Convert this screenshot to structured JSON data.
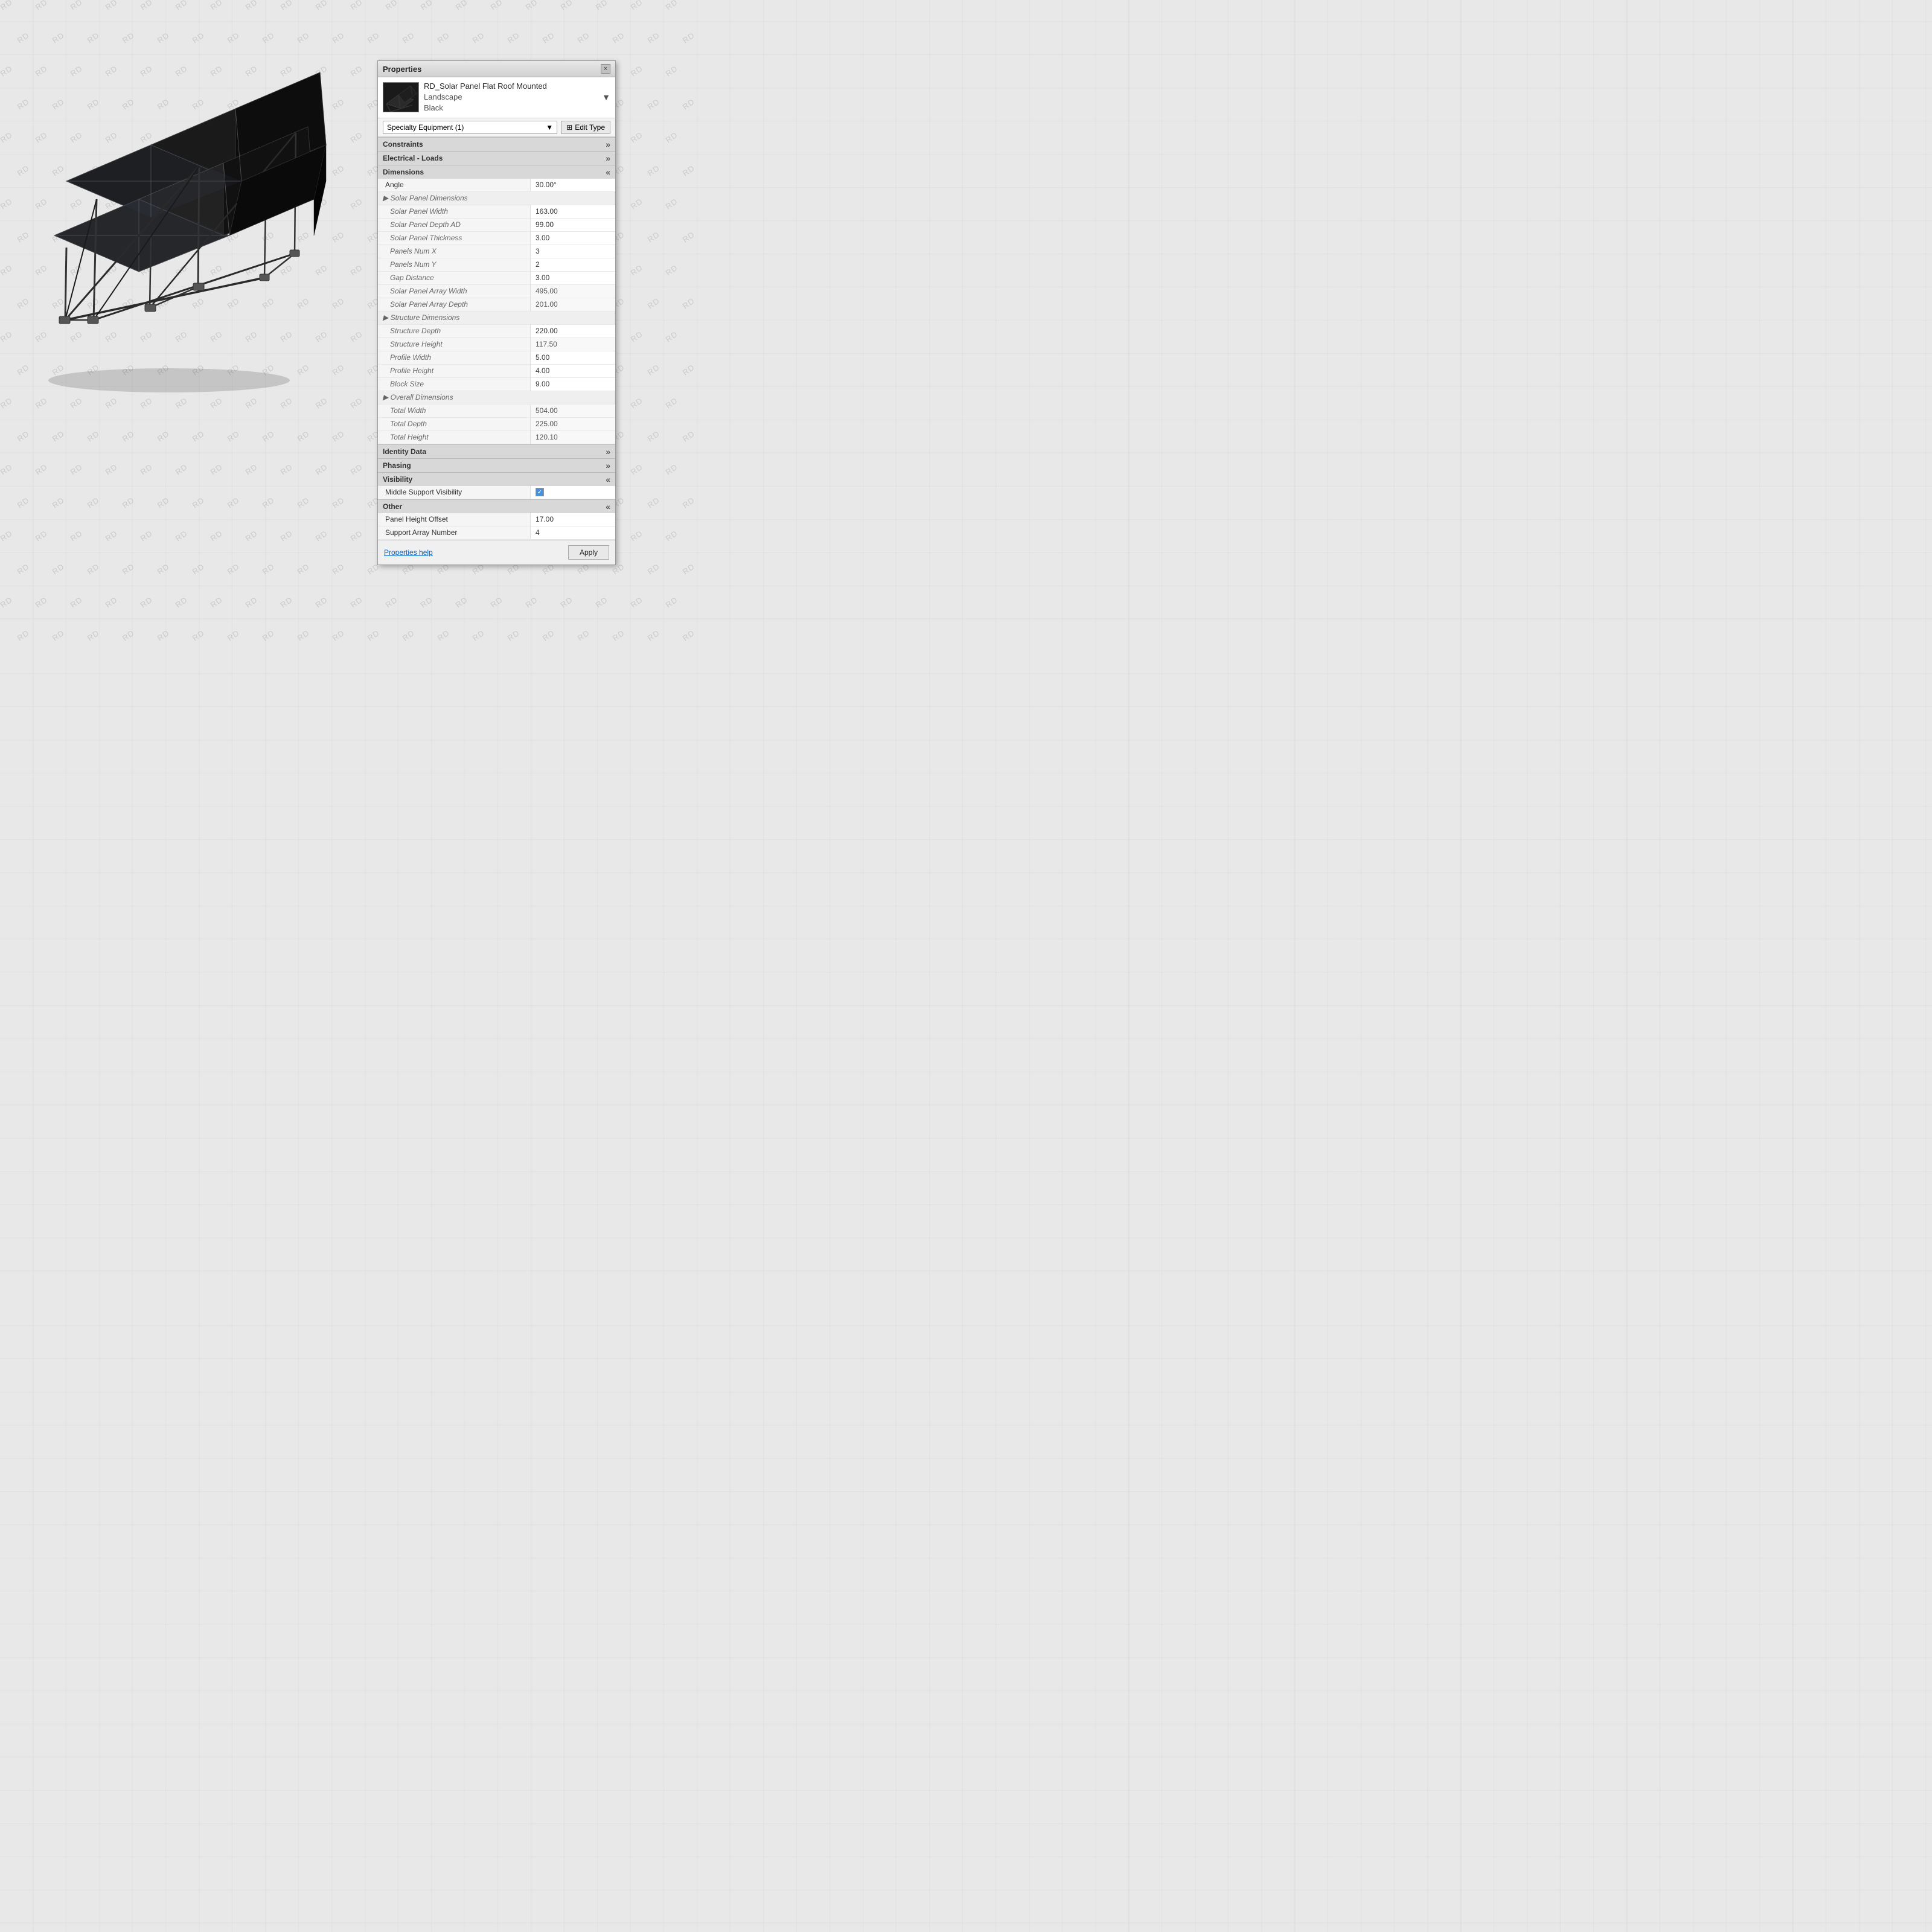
{
  "watermark": {
    "text": "RD"
  },
  "panel": {
    "title": "Properties",
    "close_label": "×",
    "item": {
      "name_line1": "RD_Solar Panel Flat Roof Mounted",
      "name_line2": "Landscape",
      "name_line3": "Black"
    },
    "dropdown": {
      "value": "Specialty Equipment (1)",
      "arrow": "▼"
    },
    "edit_type_label": "Edit Type",
    "sections": [
      {
        "id": "constraints",
        "label": "Constraints",
        "collapsed": true,
        "rows": []
      },
      {
        "id": "electrical",
        "label": "Electrical - Loads",
        "collapsed": true,
        "rows": []
      },
      {
        "id": "dimensions",
        "label": "Dimensions",
        "collapsed": false,
        "rows": [
          {
            "label": "Angle",
            "value": "30.00°",
            "editable": true,
            "indent": 0
          },
          {
            "label": "▶ Solar Panel Dimensions",
            "value": "",
            "editable": false,
            "indent": 0,
            "is_group": true
          },
          {
            "label": "Solar Panel Width",
            "value": "163.00",
            "editable": true,
            "indent": 1
          },
          {
            "label": "Solar Panel Depth AD",
            "value": "99.00",
            "editable": true,
            "indent": 1
          },
          {
            "label": "Solar Panel Thickness",
            "value": "3.00",
            "editable": true,
            "indent": 1
          },
          {
            "label": "Panels Num X",
            "value": "3",
            "editable": true,
            "indent": 1
          },
          {
            "label": "Panels Num Y",
            "value": "2",
            "editable": true,
            "indent": 1
          },
          {
            "label": "Gap Distance",
            "value": "3.00",
            "editable": true,
            "indent": 1
          },
          {
            "label": "Solar Panel Array Width",
            "value": "495.00",
            "editable": false,
            "indent": 1
          },
          {
            "label": "Solar Panel Array Depth",
            "value": "201.00",
            "editable": false,
            "indent": 1
          },
          {
            "label": "▶ Structure Dimensions",
            "value": "",
            "editable": false,
            "indent": 0,
            "is_group": true
          },
          {
            "label": "Structure Depth",
            "value": "220.00",
            "editable": true,
            "indent": 1
          },
          {
            "label": "Structure Height",
            "value": "117.50",
            "editable": false,
            "indent": 1
          },
          {
            "label": "Profile Width",
            "value": "5.00",
            "editable": true,
            "indent": 1
          },
          {
            "label": "Profile Height",
            "value": "4.00",
            "editable": true,
            "indent": 1
          },
          {
            "label": "Block Size",
            "value": "9.00",
            "editable": true,
            "indent": 1
          },
          {
            "label": "▶ Overall Dimensions",
            "value": "",
            "editable": false,
            "indent": 0,
            "is_group": true
          },
          {
            "label": "Total Width",
            "value": "504.00",
            "editable": false,
            "indent": 1
          },
          {
            "label": "Total Depth",
            "value": "225.00",
            "editable": false,
            "indent": 1
          },
          {
            "label": "Total Height",
            "value": "120.10",
            "editable": false,
            "indent": 1
          }
        ]
      },
      {
        "id": "identity",
        "label": "Identity Data",
        "collapsed": true,
        "rows": []
      },
      {
        "id": "phasing",
        "label": "Phasing",
        "collapsed": true,
        "rows": []
      },
      {
        "id": "visibility",
        "label": "Visibility",
        "collapsed": false,
        "rows": [
          {
            "label": "Middle Support Visibility",
            "value": "checkbox_checked",
            "editable": true,
            "indent": 0
          }
        ]
      },
      {
        "id": "other",
        "label": "Other",
        "collapsed": false,
        "rows": [
          {
            "label": "Panel Height Offset",
            "value": "17.00",
            "editable": true,
            "indent": 0
          },
          {
            "label": "Support Array Number",
            "value": "4",
            "editable": true,
            "indent": 0
          }
        ]
      }
    ],
    "footer": {
      "help_label": "Properties help",
      "apply_label": "Apply"
    }
  }
}
